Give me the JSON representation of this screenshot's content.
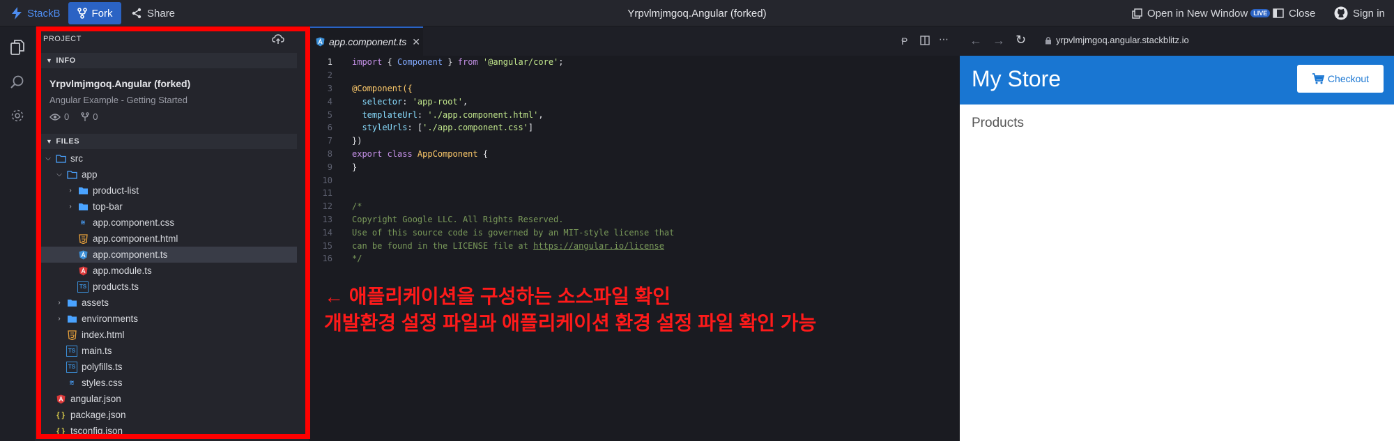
{
  "topbar": {
    "brand": "StackB",
    "fork_label": "Fork",
    "share_label": "Share",
    "window_title": "Yrpvlmjmgoq.Angular (forked)",
    "open_new_window": "Open in New Window",
    "live_badge": "LIVE",
    "close_label": "Close",
    "sign_in": "Sign in"
  },
  "sidebar": {
    "header": "PROJECT",
    "info_section": "INFO",
    "project_name": "Yrpvlmjmgoq.Angular (forked)",
    "project_desc": "Angular Example - Getting Started",
    "views": "0",
    "forks": "0",
    "files_section": "FILES",
    "tree": [
      {
        "name": "src",
        "type": "folder-open"
      },
      {
        "name": "app",
        "type": "folder-open"
      },
      {
        "name": "product-list",
        "type": "folder"
      },
      {
        "name": "top-bar",
        "type": "folder"
      },
      {
        "name": "app.component.css",
        "type": "css"
      },
      {
        "name": "app.component.html",
        "type": "html"
      },
      {
        "name": "app.component.ts",
        "type": "angular-ts"
      },
      {
        "name": "app.module.ts",
        "type": "angular"
      },
      {
        "name": "products.ts",
        "type": "ts"
      },
      {
        "name": "assets",
        "type": "folder"
      },
      {
        "name": "environments",
        "type": "folder"
      },
      {
        "name": "index.html",
        "type": "html"
      },
      {
        "name": "main.ts",
        "type": "ts"
      },
      {
        "name": "polyfills.ts",
        "type": "ts"
      },
      {
        "name": "styles.css",
        "type": "css"
      },
      {
        "name": "angular.json",
        "type": "angular"
      },
      {
        "name": "package.json",
        "type": "json"
      },
      {
        "name": "tsconfig.json",
        "type": "json"
      }
    ]
  },
  "editor": {
    "tab_label": "app.component.ts",
    "line_numbers": [
      "1",
      "2",
      "3",
      "4",
      "5",
      "6",
      "7",
      "8",
      "9",
      "10",
      "11",
      "12",
      "13",
      "14",
      "15",
      "16"
    ],
    "code": {
      "l1_kw": "import",
      "l1_a": " { ",
      "l1_id": "Component",
      "l1_b": " } ",
      "l1_from": "from",
      "l1_str": " '@angular/core'",
      "l1_end": ";",
      "l3": "@Component({",
      "l4_prop": "  selector",
      "l4_str": " 'app-root'",
      "l5_prop": "  templateUrl",
      "l5_str": " './app.component.html'",
      "l6_prop": "  styleUrls",
      "l6_str": "'./app.component.css'",
      "l7": "})",
      "l8_kw": "export class",
      "l8_cls": " AppComponent",
      "l8_end": " {",
      "l9": "}",
      "l12": "/*",
      "l13": "Copyright Google LLC. All Rights Reserved.",
      "l14": "Use of this source code is governed by an MIT-style license that",
      "l15_a": "can be found in the LICENSE file at ",
      "l15_link": "https://angular.io/license",
      "l16": "*/"
    }
  },
  "annotation": {
    "line1": "← 애플리케이션을 구성하는 소스파일 확인",
    "line2": "개발환경 설정 파일과 애플리케이션 환경 설정 파일 확인 가능"
  },
  "preview": {
    "url": "yrpvlmjmgoq.angular.stackblitz.io",
    "store_title": "My Store",
    "checkout_label": "Checkout",
    "products_heading": "Products"
  },
  "colors": {
    "accent": "#2b63c4",
    "annotation_red": "#ff0000",
    "store_blue": "#1976d2"
  }
}
